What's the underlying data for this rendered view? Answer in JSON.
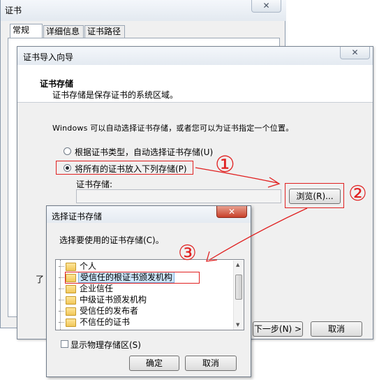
{
  "cert_window": {
    "title": "证书",
    "close_label": "✕",
    "tabs": [
      "常规",
      "详细信息",
      "证书路径"
    ]
  },
  "wizard": {
    "title": "证书导入向导",
    "close_label": "✕",
    "header_title": "证书存储",
    "header_subtitle": "证书存储是保存证书的系统区域。",
    "description": "Windows 可以自动选择证书存储，或者您可以为证书指定一个位置。",
    "option_auto": "根据证书类型，自动选择证书存储(U)",
    "option_manual": "将所有的证书放入下列存储(P)",
    "selected_option": "manual",
    "store_label": "证书存储:",
    "store_value": "",
    "browse_button": "浏览(R)...",
    "learn_prefix": "了",
    "next_button": "下一步(N) >",
    "cancel_button": "取消"
  },
  "select_store": {
    "title": "选择证书存储",
    "close_label": "✕",
    "prompt": "选择要使用的证书存储(C)。",
    "items": [
      "个人",
      "受信任的根证书颁发机构",
      "企业信任",
      "中级证书颁发机构",
      "受信任的发布者",
      "不信任的证书"
    ],
    "selected_index": 1,
    "show_physical_label": "显示物理存储区(S)",
    "show_physical_checked": false,
    "ok_button": "确定",
    "cancel_button": "取消"
  },
  "annotations": {
    "step1": "①",
    "step2": "②",
    "step3": "③",
    "color": "#e02020"
  }
}
